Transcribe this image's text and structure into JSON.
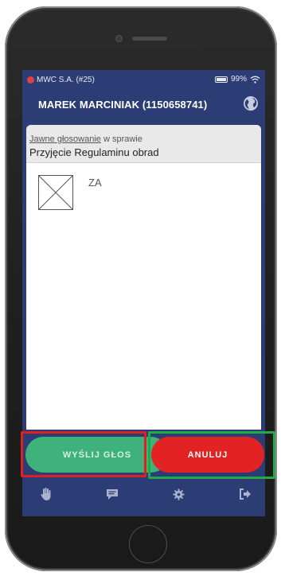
{
  "status_bar": {
    "carrier": "MWC S.A. (#25)",
    "battery": "99%"
  },
  "header": {
    "title": "MAREK MARCINIAK (1150658741)"
  },
  "vote": {
    "type_link": "Jawne głosowanie",
    "type_suffix": " w sprawie",
    "subject": "Przyjęcie Regulaminu obrad",
    "options": [
      {
        "label": "ZA",
        "checked": false
      }
    ]
  },
  "actions": {
    "send_label": "WYŚLIJ GŁOS",
    "cancel_label": "ANULUJ"
  },
  "nav": {
    "items": [
      "hand-icon",
      "comment-icon",
      "gear-icon",
      "logout-icon"
    ]
  },
  "colors": {
    "header_bg": "#2c3d75",
    "send": "#3fb17a",
    "cancel": "#e32224",
    "highlight_red": "#e02020",
    "highlight_green": "#22a94a"
  }
}
